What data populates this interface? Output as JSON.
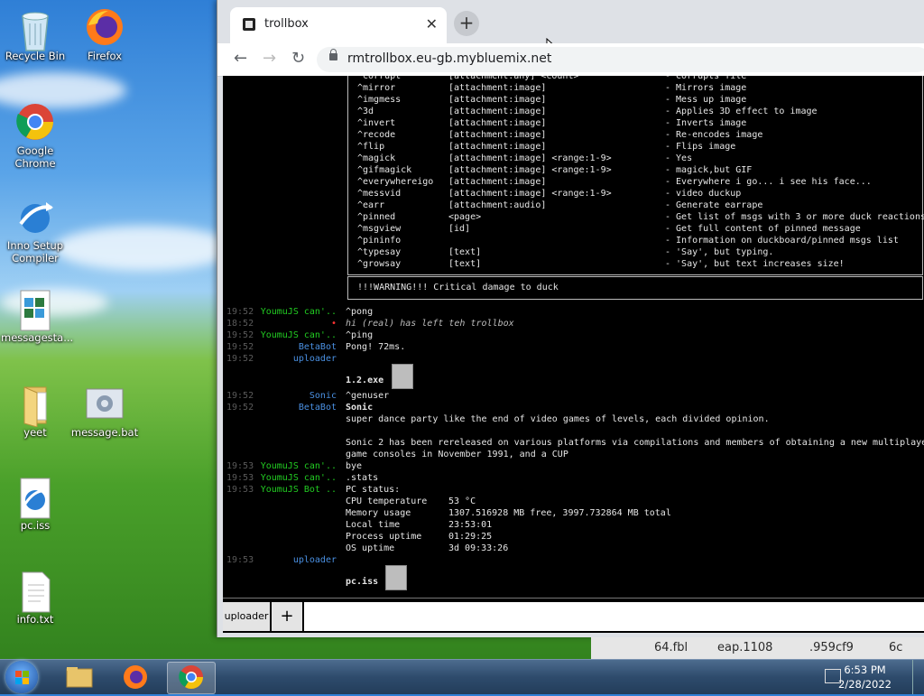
{
  "desktop": {
    "icons": [
      {
        "label": "Recycle Bin"
      },
      {
        "label": "Firefox"
      },
      {
        "label": "Google Chrome"
      },
      {
        "label": "Inno Setup Compiler"
      },
      {
        "label": "messagesta..."
      },
      {
        "label": "yeet"
      },
      {
        "label": "message.bat"
      },
      {
        "label": "pc.iss"
      },
      {
        "label": "info.txt"
      }
    ]
  },
  "browser": {
    "tab_title": "trollbox",
    "tab_close": "✕",
    "new_tab": "+",
    "url": "rmtrollbox.eu-gb.mybluemix.net",
    "back": "←",
    "forward": "→",
    "reload": "↻"
  },
  "help_rows": [
    {
      "cmd": "^corrupt",
      "args": "[attachment:any] <count>",
      "desc": "- Corrupts file"
    },
    {
      "cmd": "^mirror",
      "args": "[attachment:image]",
      "desc": "- Mirrors image"
    },
    {
      "cmd": "^imgmess",
      "args": "[attachment:image]",
      "desc": "- Mess up image"
    },
    {
      "cmd": "^3d",
      "args": "[attachment:image]",
      "desc": "- Applies 3D effect to image"
    },
    {
      "cmd": "^invert",
      "args": "[attachment:image]",
      "desc": "- Inverts image"
    },
    {
      "cmd": "^recode",
      "args": "[attachment:image]",
      "desc": "- Re-encodes image"
    },
    {
      "cmd": "^flip",
      "args": "[attachment:image]",
      "desc": "- Flips image"
    },
    {
      "cmd": "^magick",
      "args": "[attachment:image] <range:1-9>",
      "desc": "- Yes"
    },
    {
      "cmd": "^gifmagick",
      "args": "[attachment:image] <range:1-9>",
      "desc": "- magick,but GIF"
    },
    {
      "cmd": "^everywhereigo",
      "args": "[attachment:image]",
      "desc": "- Everywhere i go... i see his face..."
    },
    {
      "cmd": "^messvid",
      "args": "[attachment:image] <range:1-9>",
      "desc": "- video duckup"
    },
    {
      "cmd": "^earr",
      "args": "[attachment:audio]",
      "desc": "- Generate earrape"
    },
    {
      "cmd": "^pinned",
      "args": "<page>",
      "desc": "- Get list of msgs with 3 or more duck reactions"
    },
    {
      "cmd": "^msgview",
      "args": "[id]",
      "desc": "- Get full content of pinned message"
    },
    {
      "cmd": "^pininfo",
      "args": "",
      "desc": "- Information on duckboard/pinned msgs list"
    },
    {
      "cmd": "^typesay",
      "args": "[text]",
      "desc": "- 'Say', but typing."
    },
    {
      "cmd": "^growsay",
      "args": "[text]",
      "desc": "- 'Say', but text increases size!"
    }
  ],
  "warning": "!!!WARNING!!! Critical damage to duck",
  "messages": [
    {
      "time": "19:52",
      "nick": "YoumuJS can'..",
      "nick_color": "#22cc22",
      "text": "^pong"
    },
    {
      "time": "18:52",
      "nick": "•",
      "nick_color": "#ff3333",
      "text": "hi (real) has left teh trollbox",
      "system": true
    },
    {
      "time": "19:52",
      "nick": "YoumuJS can'..",
      "nick_color": "#22cc22",
      "text": "^ping"
    },
    {
      "time": "19:52",
      "nick": "BetaBot",
      "nick_color": "#4a90e2",
      "text": "Pong! 72ms."
    },
    {
      "time": "19:52",
      "nick": "uploader",
      "nick_color": "#4a90e2",
      "text": ""
    },
    {
      "time": "19:52",
      "nick": "Sonic",
      "nick_color": "#4a90e2",
      "text": "^genuser"
    },
    {
      "time": "19:52",
      "nick": "BetaBot",
      "nick_color": "#4a90e2",
      "text": "Sonic"
    },
    {
      "time": "",
      "nick": "",
      "nick_color": "#e6e6e6",
      "text": "super dance party like the end of video games of levels, each divided opinion."
    },
    {
      "time": "",
      "nick": "",
      "nick_color": "#e6e6e6",
      "text": "Sonic 2 has been rereleased on various platforms via compilations and members of obtaining a new multiplaye"
    },
    {
      "time": "",
      "nick": "",
      "nick_color": "#e6e6e6",
      "text": "game consoles in November 1991, and a CUP"
    },
    {
      "time": "19:53",
      "nick": "YoumuJS can'..",
      "nick_color": "#22cc22",
      "text": "bye"
    },
    {
      "time": "19:53",
      "nick": "YoumuJS can'..",
      "nick_color": "#22cc22",
      "text": ".stats"
    },
    {
      "time": "19:53",
      "nick": "YoumuJS Bot ..",
      "nick_color": "#22cc22",
      "text": " PC status:"
    }
  ],
  "stats": [
    {
      "k": "CPU temperature",
      "v": "53 °C"
    },
    {
      "k": "Memory usage",
      "v": "1307.516928 MB free, 3997.732864 MB total"
    },
    {
      "k": "Local time",
      "v": "23:53:01"
    },
    {
      "k": "Process uptime",
      "v": "01:29:25"
    },
    {
      "k": "OS uptime",
      "v": "3d 09:33:26"
    }
  ],
  "uploads": [
    {
      "time": "19:52",
      "nick": "uploader",
      "file": "1.2.exe"
    },
    {
      "time": "19:53",
      "nick": "uploader",
      "file": "pc.iss"
    }
  ],
  "input": {
    "nick": "uploader",
    "plus": "+"
  },
  "bg_text": {
    "a": "64.fbl",
    "b": "eap.1108",
    "c": ".959cf9",
    "d": "6c"
  },
  "taskbar": {
    "time": "6:53 PM",
    "date": "2/28/2022"
  }
}
